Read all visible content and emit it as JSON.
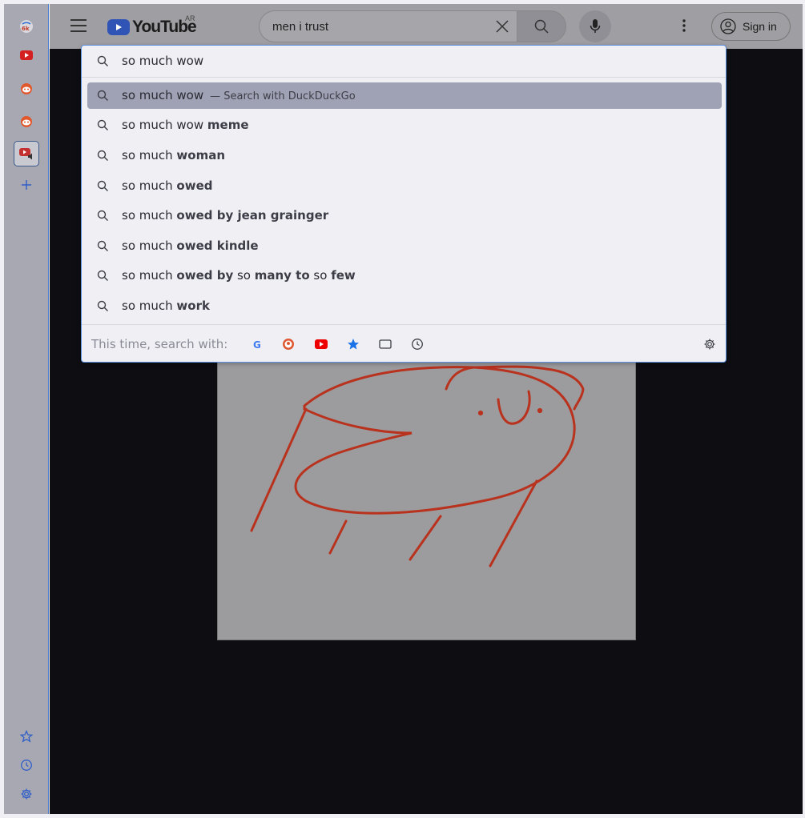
{
  "sidebar": {
    "panels": [
      {
        "icon": "6k-feed-icon"
      },
      {
        "icon": "youtube-icon"
      },
      {
        "icon": "reddit-icon"
      },
      {
        "icon": "reddit-icon"
      },
      {
        "icon": "youtube-playing-icon",
        "active": true
      }
    ],
    "bottom": [
      {
        "icon": "star-icon"
      },
      {
        "icon": "clock-icon"
      },
      {
        "icon": "gear-icon"
      }
    ]
  },
  "youtube": {
    "logo_text": "YouTube",
    "country_code": "AR",
    "search_value": "men i trust",
    "signin_label": "Sign in"
  },
  "urlbar": {
    "typed": "so much wow",
    "suggestions": [
      {
        "prefix": "so much wow",
        "bold": "",
        "subtitle": "— Search with DuckDuckGo",
        "selected": true
      },
      {
        "prefix": "so much wow ",
        "bold": "meme"
      },
      {
        "prefix": "so much ",
        "bold": "woman"
      },
      {
        "prefix": "so much ",
        "bold": "owed"
      },
      {
        "prefix": "so much ",
        "bold": "owed by jean grainger"
      },
      {
        "prefix": "so much ",
        "bold": "owed kindle"
      },
      {
        "prefix": "so much ",
        "bold": "owed by",
        "rest": [
          " so ",
          "many to",
          " so ",
          "few"
        ]
      },
      {
        "prefix": "so much ",
        "bold": "work"
      }
    ],
    "footer_label": "This time, search with:",
    "engines": [
      "google-icon",
      "duckduckgo-icon",
      "youtube-icon",
      "bookmarks-star-icon",
      "tabs-icon",
      "history-icon"
    ]
  }
}
